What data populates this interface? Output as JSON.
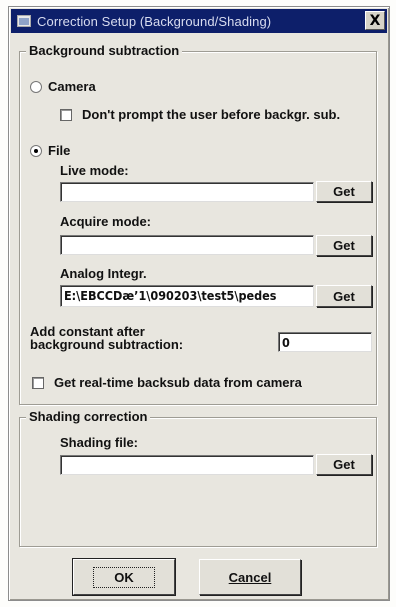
{
  "window": {
    "title": "Correction Setup (Background/Shading)",
    "close_glyph": "X"
  },
  "background": {
    "group_label": "Background subtraction",
    "camera_label": "Camera",
    "dont_prompt_label": "Don't prompt the user before backgr. sub.",
    "file_label": "File",
    "live_mode_label": "Live mode:",
    "live_mode_value": "",
    "acquire_mode_label": "Acquire mode:",
    "acquire_mode_value": "",
    "analog_label": "Analog Integr.",
    "analog_value": "E:\\EBCCDæ’1\\090203\\test5\\pedes",
    "get_label": "Get",
    "add_constant_label_1": "Add constant after",
    "add_constant_label_2": "background subtraction:",
    "add_constant_value": "0",
    "realtime_label": "Get real-time backsub data from camera",
    "selected_source": "File"
  },
  "shading": {
    "group_label": "Shading correction",
    "file_label": "Shading file:",
    "file_value": "",
    "get_label": "Get"
  },
  "footer": {
    "ok_label": "OK",
    "cancel_label": "Cancel"
  }
}
